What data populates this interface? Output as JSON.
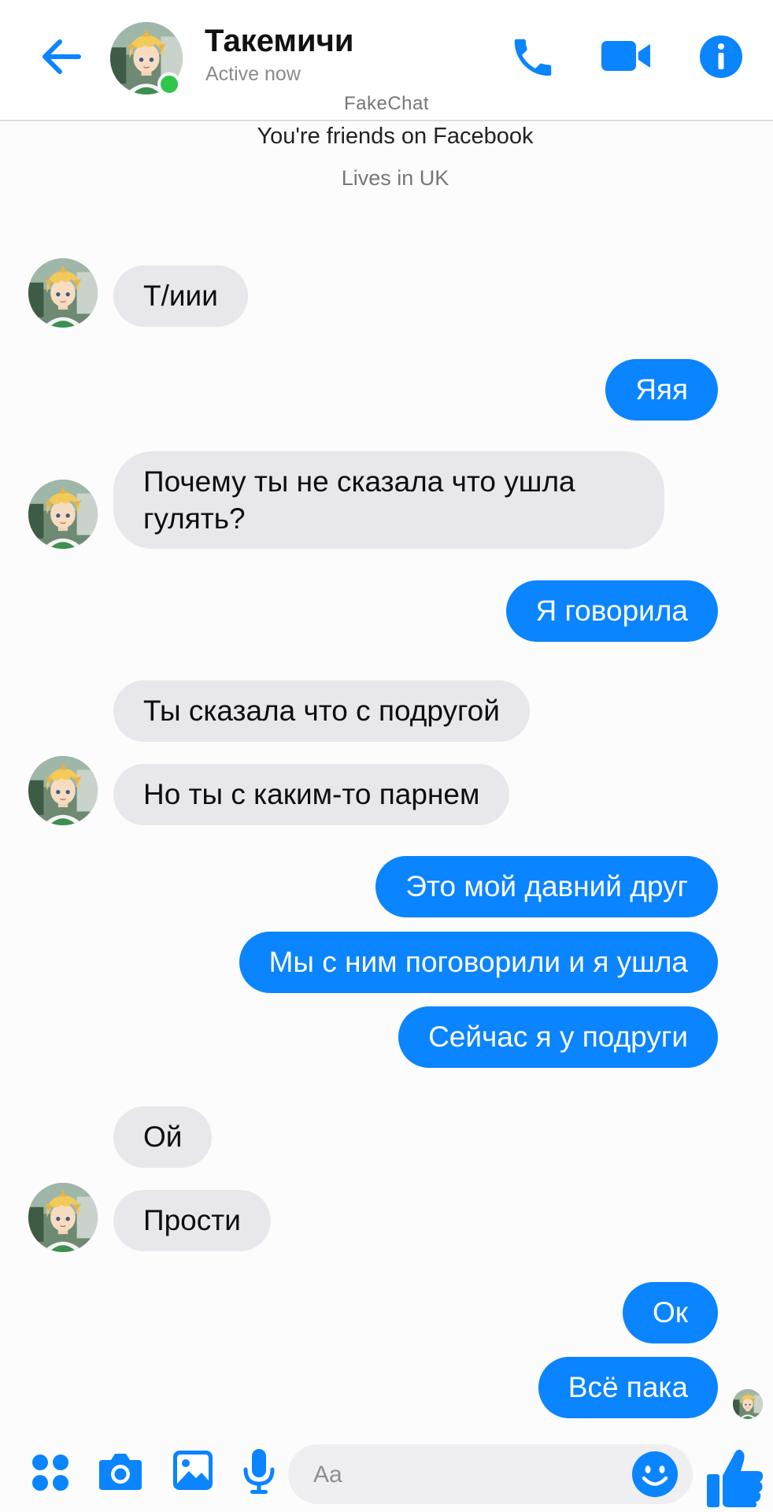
{
  "app": {
    "watermark": "FakeChat"
  },
  "header": {
    "contact_name": "Такемичи",
    "status": "Active now",
    "icons": {
      "back": "arrow-left-icon",
      "call": "phone-icon",
      "video": "video-camera-icon",
      "info": "info-icon"
    }
  },
  "profile_info": {
    "friends": "You're friends on Facebook",
    "location": "Lives in UK"
  },
  "messages": [
    {
      "from": "them",
      "text": "Т/иии"
    },
    {
      "from": "me",
      "text": "Яяя"
    },
    {
      "from": "them",
      "text": "Почему ты не сказала что ушла гулять?"
    },
    {
      "from": "me",
      "text": "Я говорила"
    },
    {
      "from": "them",
      "text": "Ты сказала что с подругой"
    },
    {
      "from": "them",
      "text": "Но ты с каким-то парнем"
    },
    {
      "from": "me",
      "text": "Это мой давний друг"
    },
    {
      "from": "me",
      "text": "Мы с ним поговорили и я ушла"
    },
    {
      "from": "me",
      "text": "Сейчас я у подруги"
    },
    {
      "from": "them",
      "text": "Ой"
    },
    {
      "from": "them",
      "text": "Прости"
    },
    {
      "from": "me",
      "text": "Ок"
    },
    {
      "from": "me",
      "text": "Всё пака"
    }
  ],
  "composer": {
    "placeholder": "Aa",
    "icons": [
      "menu-grid-icon",
      "camera-icon",
      "image-icon",
      "microphone-icon",
      "emoji-icon",
      "thumbs-up-icon"
    ]
  },
  "colors": {
    "accent": "#0a84ff",
    "incoming_bubble": "#e8e8ec",
    "online": "#31c54a"
  }
}
